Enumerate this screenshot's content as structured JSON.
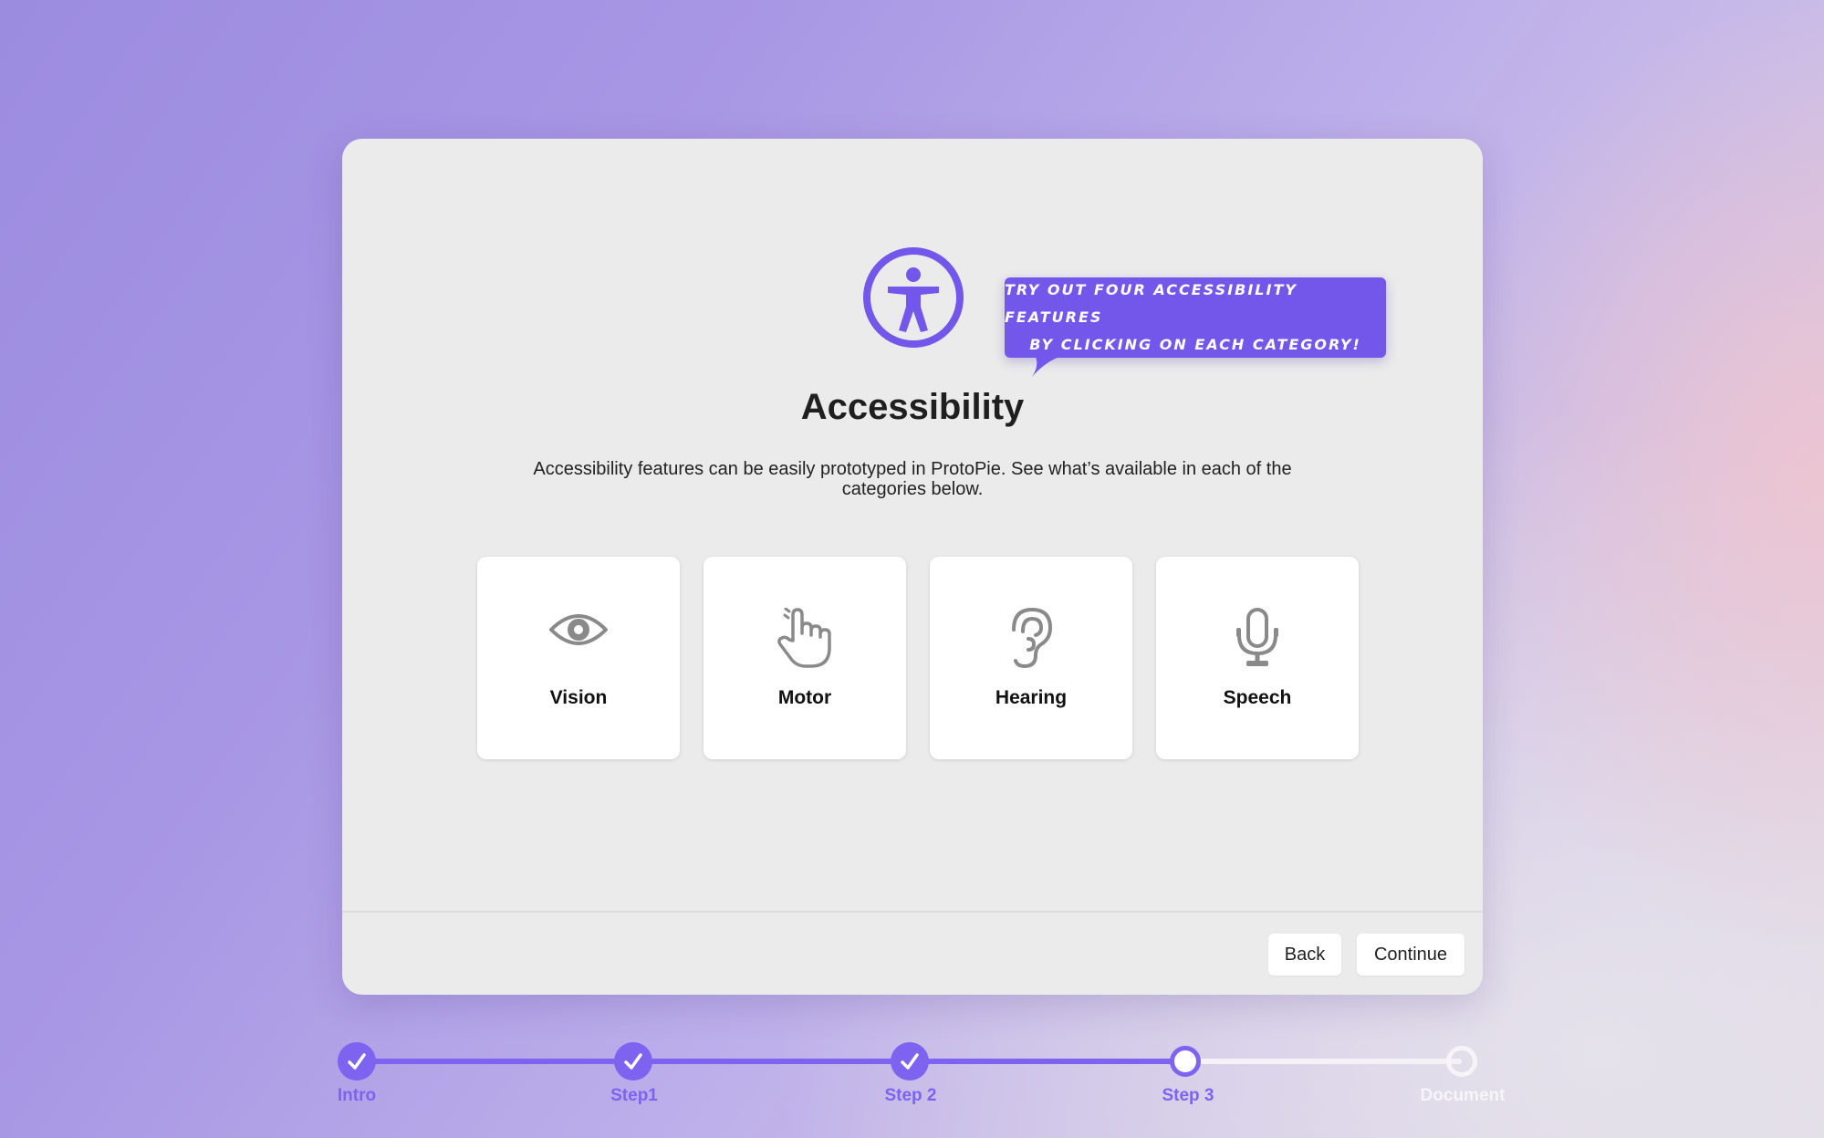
{
  "dialog": {
    "tooltip": {
      "line1": "TRY OUT FOUR ACCESSIBILITY FEATURES",
      "line2": "BY CLICKING ON EACH CATEGORY!"
    },
    "title": "Accessibility",
    "description": "Accessibility features can be easily prototyped in ProtoPie. See what’s available in each of the categories below.",
    "categories": [
      {
        "label": "Vision",
        "icon": "eye-icon"
      },
      {
        "label": "Motor",
        "icon": "pointing-hand-icon"
      },
      {
        "label": "Hearing",
        "icon": "ear-icon"
      },
      {
        "label": "Speech",
        "icon": "microphone-icon"
      }
    ],
    "buttons": {
      "back": "Back",
      "continue": "Continue"
    }
  },
  "stepper": {
    "steps": [
      {
        "label": "Intro",
        "status": "completed"
      },
      {
        "label": "Step1",
        "status": "completed"
      },
      {
        "label": "Step 2",
        "status": "completed"
      },
      {
        "label": "Step 3",
        "status": "current"
      },
      {
        "label": "Document",
        "status": "upcoming"
      }
    ]
  },
  "colors": {
    "accent": "#7257ea",
    "progress": "#7e62f0",
    "dialog_bg": "#ebebeb",
    "icon_gray": "#8a8a8a"
  }
}
